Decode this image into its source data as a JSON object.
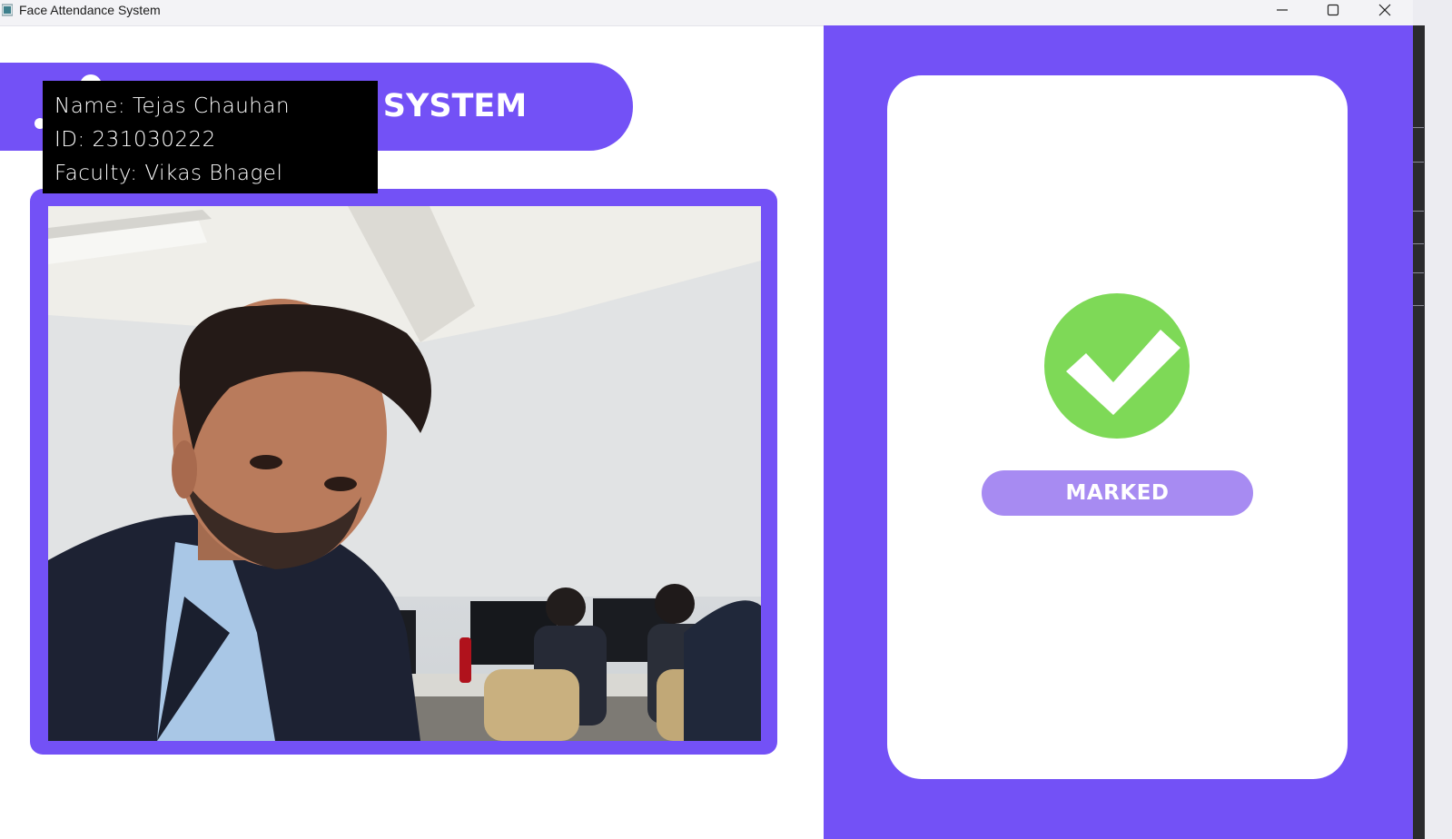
{
  "window": {
    "title": "Face Attendance System",
    "icon": "app-icon",
    "controls": [
      "minimize-icon",
      "maximize-icon",
      "close-icon"
    ]
  },
  "header": {
    "visible_title": "CE SYSTEM"
  },
  "recognition": {
    "name_line": "Name: Tejas Chauhan",
    "id_line": "ID: 231030222",
    "faculty_line": "Faculty: Vikas Bhagel"
  },
  "camera": {
    "feed": "webcam-feed"
  },
  "status": {
    "icon": "check-circle-icon",
    "label": "MARKED"
  },
  "colors": {
    "accent": "#7351f6",
    "pill": "#a78bf2",
    "success": "#7ed957"
  }
}
